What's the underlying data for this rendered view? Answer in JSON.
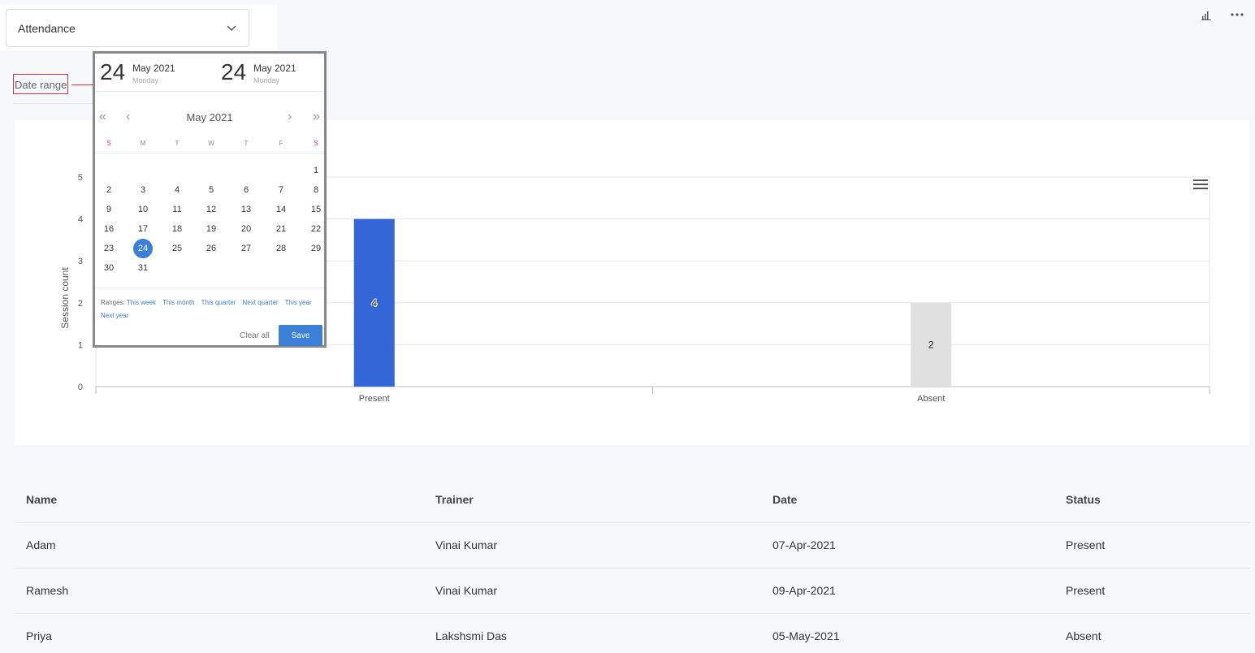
{
  "filter": {
    "selected": "Attendance"
  },
  "date_range_label": "Date range",
  "calendar": {
    "start": {
      "day": "24",
      "month_year": "May 2021",
      "weekday": "Monday"
    },
    "end": {
      "day": "24",
      "month_year": "May 2021",
      "weekday": "Monday"
    },
    "month_title": "May 2021",
    "weekdays": [
      "S",
      "M",
      "T",
      "W",
      "T",
      "F",
      "S"
    ],
    "days_start_offset": 6,
    "days_in_month": 31,
    "selected_day": 24,
    "ranges_label": "Ranges:",
    "ranges": [
      "This week",
      "This month",
      "This quarter",
      "Next quarter",
      "This year",
      "Next year"
    ],
    "clear_label": "Clear all",
    "save_label": "Save"
  },
  "chart_data": {
    "type": "bar",
    "categories": [
      "Present",
      "Absent"
    ],
    "values": [
      4,
      2
    ],
    "colors": [
      "#3366d6",
      "#e0e0e0"
    ],
    "ylabel": "Session count",
    "xlabel": "",
    "ylim": [
      0,
      5
    ],
    "yticks": [
      0,
      1,
      2,
      3,
      4,
      5
    ],
    "grid": true,
    "data_labels": [
      "4",
      "2"
    ]
  },
  "table": {
    "headers": [
      "Name",
      "Trainer",
      "Date",
      "Status"
    ],
    "rows": [
      [
        "Adam",
        "Vinai Kumar",
        "07-Apr-2021",
        "Present"
      ],
      [
        "Ramesh",
        "Vinai Kumar",
        "09-Apr-2021",
        "Present"
      ],
      [
        "Priya",
        "Lakshsmi Das",
        "05-May-2021",
        "Absent"
      ]
    ]
  }
}
